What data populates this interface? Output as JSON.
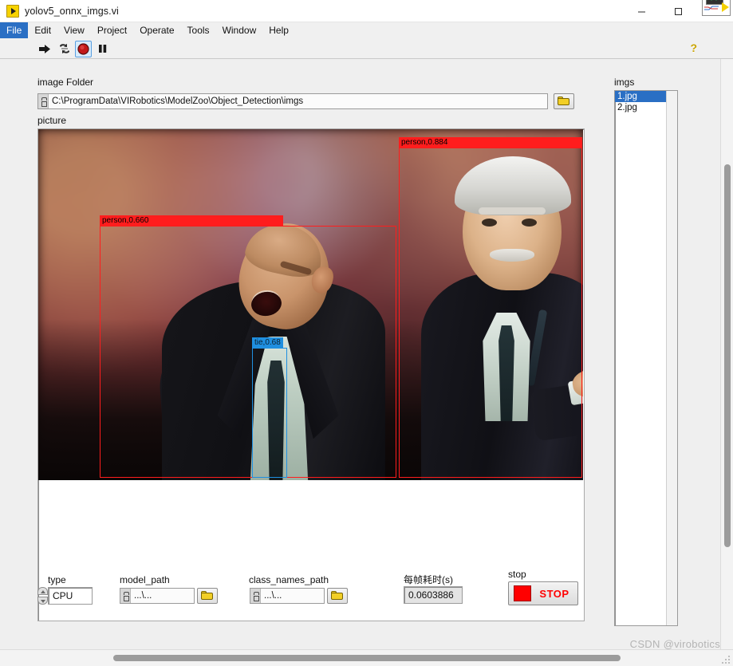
{
  "window": {
    "title": "yolov5_onnx_imgs.vi",
    "icon": "labview-vi-icon",
    "minimize_label": "—",
    "maximize_label": "□",
    "close_label": "✕"
  },
  "menubar": {
    "items": [
      {
        "label": "File",
        "active": true
      },
      {
        "label": "Edit",
        "active": false
      },
      {
        "label": "View",
        "active": false
      },
      {
        "label": "Project",
        "active": false
      },
      {
        "label": "Operate",
        "active": false
      },
      {
        "label": "Tools",
        "active": false
      },
      {
        "label": "Window",
        "active": false
      },
      {
        "label": "Help",
        "active": false
      }
    ]
  },
  "toolbar": {
    "buttons": [
      {
        "name": "run-arrow-icon",
        "selected": false
      },
      {
        "name": "run-continuously-icon",
        "selected": false
      },
      {
        "name": "abort-execution-icon",
        "selected": true
      },
      {
        "name": "pause-icon",
        "selected": false
      }
    ],
    "context_help_label": "?",
    "vi_thumbnail_name": "vi-icon-thumbnail"
  },
  "panel": {
    "image_folder": {
      "label": "image Folder",
      "value": "C:\\ProgramData\\VIRobotics\\ModelZoo\\Object_Detection\\imgs",
      "browse_name": "folder-browse-icon"
    },
    "picture": {
      "label": "picture",
      "detections": [
        {
          "label": "person,0.660",
          "color": "#ff1d1d"
        },
        {
          "label": "person,0.884",
          "color": "#ff1d1d"
        },
        {
          "label": "tie,0.68",
          "color": "#1f8fe0"
        }
      ]
    },
    "imgs": {
      "label": "imgs",
      "items": [
        {
          "name": "1.jpg",
          "selected": true
        },
        {
          "name": "2.jpg",
          "selected": false
        }
      ]
    },
    "type": {
      "label": "type",
      "value": "CPU"
    },
    "model_path": {
      "label": "model_path",
      "value": "...\\...",
      "browse_name": "folder-browse-icon"
    },
    "class_names_path": {
      "label": "class_names_path",
      "value": "...\\...",
      "browse_name": "folder-browse-icon"
    },
    "frame_time": {
      "label": "每帧耗时(s)",
      "value": "0.0603886"
    },
    "stop": {
      "label": "stop",
      "button_label": "STOP"
    }
  },
  "watermark": {
    "text": "CSDN @virobotics"
  },
  "colors": {
    "menu_highlight": "#2a6fc4",
    "detection_person": "#ff1d1d",
    "detection_tie": "#1f8fe0",
    "stop_red": "#ff0000",
    "panel_bg": "#efefef"
  }
}
